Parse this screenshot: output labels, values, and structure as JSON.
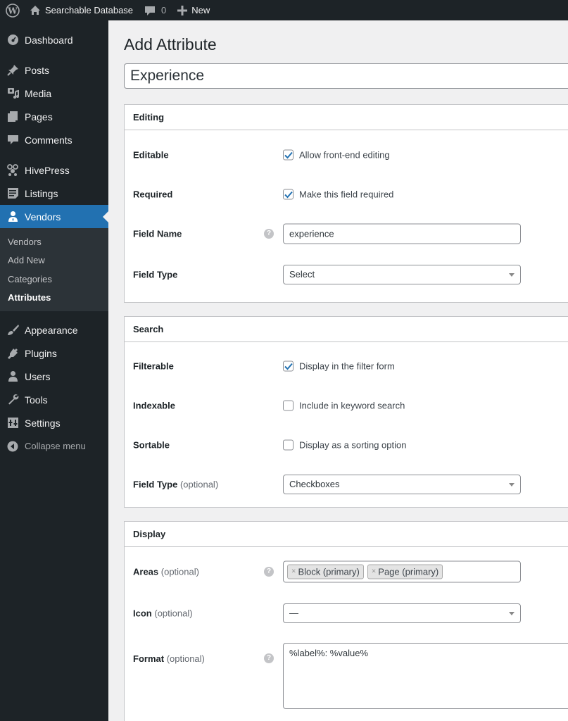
{
  "adminbar": {
    "site_name": "Searchable Database",
    "comments_count": "0",
    "new_label": "New"
  },
  "sidebar": {
    "items": [
      {
        "label": "Dashboard",
        "icon": "dashboard-icon"
      },
      {
        "label": "Posts",
        "icon": "pin-icon"
      },
      {
        "label": "Media",
        "icon": "media-icon"
      },
      {
        "label": "Pages",
        "icon": "pages-icon"
      },
      {
        "label": "Comments",
        "icon": "comment-icon"
      },
      {
        "label": "HivePress",
        "icon": "hivepress-icon"
      },
      {
        "label": "Listings",
        "icon": "listings-icon"
      },
      {
        "label": "Vendors",
        "icon": "user-icon",
        "current": true
      },
      {
        "label": "Appearance",
        "icon": "brush-icon"
      },
      {
        "label": "Plugins",
        "icon": "plugin-icon"
      },
      {
        "label": "Users",
        "icon": "users-icon"
      },
      {
        "label": "Tools",
        "icon": "wrench-icon"
      },
      {
        "label": "Settings",
        "icon": "settings-icon"
      }
    ],
    "submenu": [
      "Vendors",
      "Add New",
      "Categories",
      "Attributes"
    ],
    "submenu_current": "Attributes",
    "collapse_label": "Collapse menu"
  },
  "main": {
    "page_title": "Add Attribute",
    "title_value": "Experience",
    "editing": {
      "heading": "Editing",
      "editable": {
        "label": "Editable",
        "checkbox_label": "Allow front-end editing",
        "checked": true
      },
      "required": {
        "label": "Required",
        "checkbox_label": "Make this field required",
        "checked": true
      },
      "field_name": {
        "label": "Field Name",
        "value": "experience"
      },
      "field_type": {
        "label": "Field Type",
        "value": "Select"
      }
    },
    "search": {
      "heading": "Search",
      "filterable": {
        "label": "Filterable",
        "checkbox_label": "Display in the filter form",
        "checked": true
      },
      "indexable": {
        "label": "Indexable",
        "checkbox_label": "Include in keyword search",
        "checked": false
      },
      "sortable": {
        "label": "Sortable",
        "checkbox_label": "Display as a sorting option",
        "checked": false
      },
      "field_type": {
        "label": "Field Type",
        "optional": "(optional)",
        "value": "Checkboxes"
      }
    },
    "display": {
      "heading": "Display",
      "areas": {
        "label": "Areas",
        "optional": "(optional)",
        "tags": [
          "Block (primary)",
          "Page (primary)"
        ]
      },
      "icon": {
        "label": "Icon",
        "optional": "(optional)",
        "value": "—"
      },
      "format": {
        "label": "Format",
        "optional": "(optional)",
        "value": "%label%: %value%"
      }
    },
    "help_glyph": "?",
    "tag_remove_glyph": "×"
  },
  "colors": {
    "accent": "#2271b1",
    "sidebar_bg": "#1d2327",
    "submenu_bg": "#2c3338",
    "page_bg": "#f0f0f1"
  }
}
